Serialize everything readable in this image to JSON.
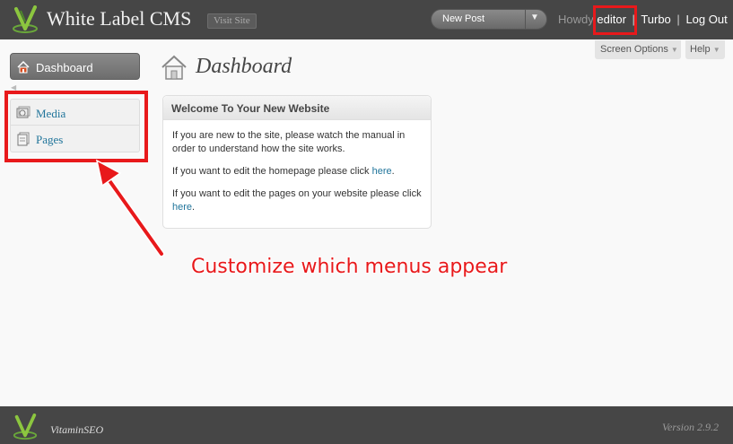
{
  "header": {
    "site_title": "White Label CMS",
    "visit_site": "Visit Site",
    "new_post": "New Post",
    "howdy": "Howdy",
    "user": "editor",
    "turbo": "Turbo",
    "separator": "|",
    "logout": "Log Out"
  },
  "tabs": {
    "screen_options": "Screen Options",
    "help": "Help"
  },
  "sidebar": {
    "dashboard": "Dashboard",
    "items": [
      {
        "label": "Media",
        "icon": "media-icon"
      },
      {
        "label": "Pages",
        "icon": "pages-icon"
      }
    ]
  },
  "main": {
    "title": "Dashboard",
    "widget": {
      "title": "Welcome To Your New Website",
      "p1": "If you are new to the site, please watch the manual in order to understand how the site works.",
      "p2_before": "If you want to edit the homepage please click ",
      "p2_link": "here",
      "p2_after": ".",
      "p3_before": "If you want to edit the pages on your website please click ",
      "p3_link": "here",
      "p3_after": "."
    }
  },
  "annotation": "Customize which menus appear",
  "footer": {
    "brand": "VitaminSEO",
    "version": "Version 2.9.2"
  },
  "colors": {
    "header_bg": "#464646",
    "link": "#21759b",
    "highlight_red": "#e8191b",
    "logo_green": "#6aa83a"
  }
}
